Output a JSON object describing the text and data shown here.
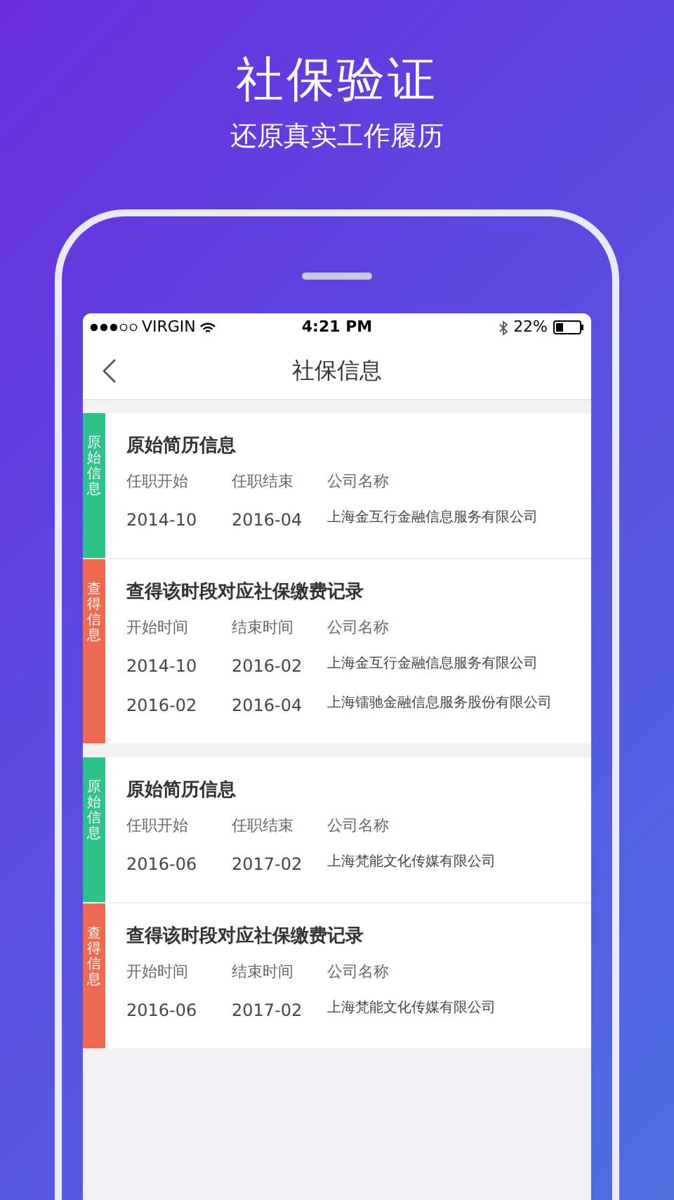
{
  "headline": "社保验证",
  "subheadline": "还原真实工作履历",
  "status_bar": {
    "carrier": "VIRGIN",
    "time": "4:21 PM",
    "battery": "22%"
  },
  "nav": {
    "title": "社保信息"
  },
  "groups": [
    {
      "sections": [
        {
          "kind": "original",
          "tag": "原始信息",
          "title": "原始简历信息",
          "headers": [
            "任职开始",
            "任职结束",
            "公司名称"
          ],
          "rows": [
            [
              "2014-10",
              "2016-04",
              "上海金互行金融信息服务有限公司"
            ]
          ]
        },
        {
          "kind": "record",
          "tag": "查得信息",
          "title": "查得该时段对应社保缴费记录",
          "headers": [
            "开始时间",
            "结束时间",
            "公司名称"
          ],
          "rows": [
            [
              "2014-10",
              "2016-02",
              "上海金互行金融信息服务有限公司"
            ],
            [
              "2016-02",
              "2016-04",
              "上海镭驰金融信息服务股份有限公司"
            ]
          ]
        }
      ]
    },
    {
      "sections": [
        {
          "kind": "original",
          "tag": "原始信息",
          "title": "原始简历信息",
          "headers": [
            "任职开始",
            "任职结束",
            "公司名称"
          ],
          "rows": [
            [
              "2016-06",
              "2017-02",
              "上海梵能文化传媒有限公司"
            ]
          ]
        },
        {
          "kind": "record",
          "tag": "查得信息",
          "title": "查得该时段对应社保缴费记录",
          "headers": [
            "开始时间",
            "结束时间",
            "公司名称"
          ],
          "rows": [
            [
              "2016-06",
              "2017-02",
              "上海梵能文化传媒有限公司"
            ]
          ]
        }
      ]
    }
  ]
}
